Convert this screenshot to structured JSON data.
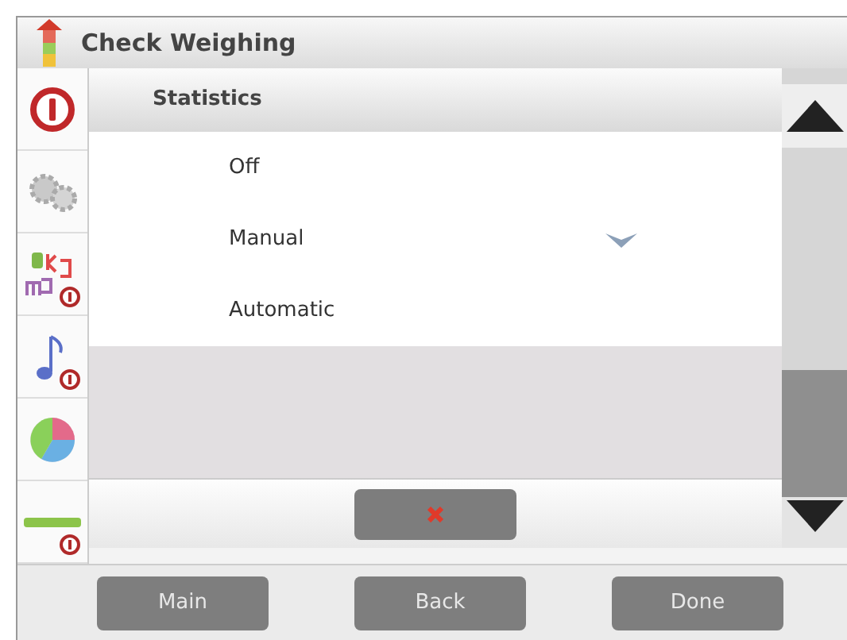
{
  "window": {
    "title": "Check Weighing"
  },
  "dialog": {
    "title": "Statistics",
    "options": [
      {
        "label": "Off",
        "selected": false
      },
      {
        "label": "Manual",
        "selected": true
      },
      {
        "label": "Automatic",
        "selected": false
      }
    ]
  },
  "buttons": [
    "Main",
    "Back",
    "Done"
  ]
}
